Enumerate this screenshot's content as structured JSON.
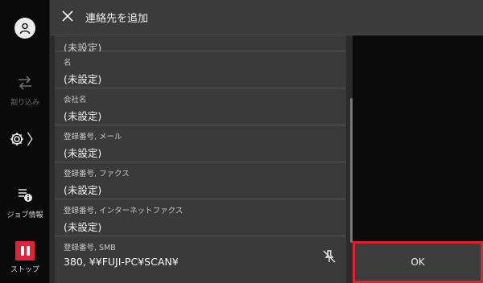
{
  "header": {
    "title": "連絡先を追加"
  },
  "rail": {
    "interrupt_label": "割り込み",
    "job_status_label": "ジョブ情報",
    "stop_label": "ストップ"
  },
  "fields": [
    {
      "label": "(未設定)",
      "value": ""
    },
    {
      "label": "名",
      "value": "(未設定)"
    },
    {
      "label": "会社名",
      "value": "(未設定)"
    },
    {
      "label": "登録番号, メール",
      "value": "(未設定)"
    },
    {
      "label": "登録番号, ファクス",
      "value": "(未設定)"
    },
    {
      "label": "登録番号, インターネットファクス",
      "value": "(未設定)"
    },
    {
      "label": "登録番号, SMB",
      "value": "380, ¥¥FUJI-PC¥SCAN¥"
    }
  ],
  "actions": {
    "ok_label": "OK"
  },
  "icons": [
    "user-icon",
    "interrupt-icon",
    "gear-icon",
    "job-status-icon",
    "stop-icon",
    "close-icon",
    "unpin-icon"
  ],
  "colors": {
    "stop": "#e0233c",
    "highlight": "#e2202f"
  }
}
